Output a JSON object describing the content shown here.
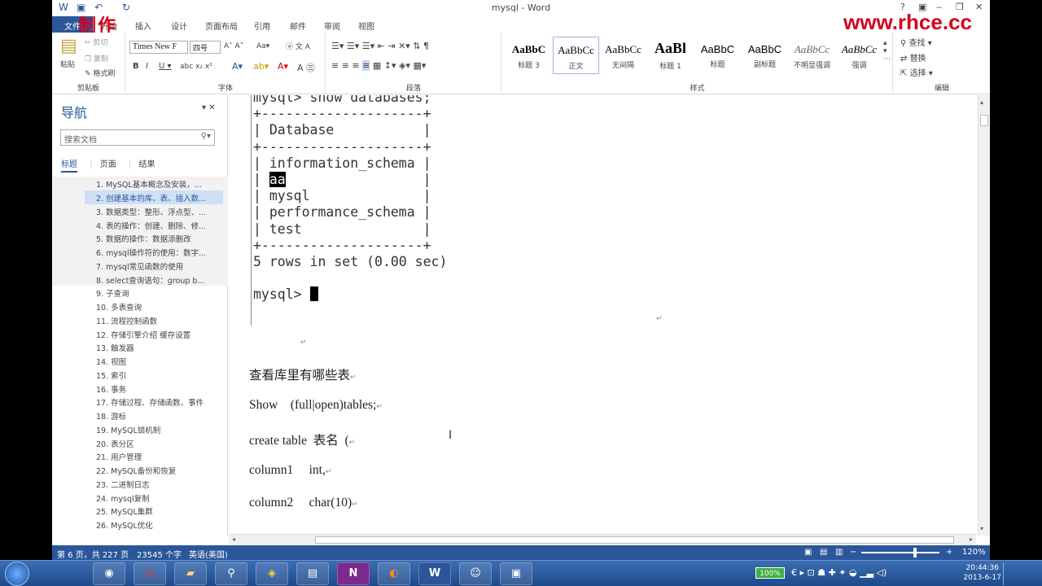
{
  "titlebar": {
    "title": "mysql - Word",
    "help": "?",
    "restore": "▣",
    "minimize": "‒",
    "maximize": "❐",
    "close": "✕"
  },
  "watermark": {
    "left": "制作",
    "right": "www.rhce.cc"
  },
  "tabs": [
    "文件",
    "开始",
    "插入",
    "设计",
    "页面布局",
    "引用",
    "邮件",
    "审阅",
    "视图"
  ],
  "ribbon": {
    "clipboard": {
      "paste": "粘贴",
      "cut": "剪切",
      "copy": "复制",
      "format_painter": "格式刷",
      "label": "剪贴板"
    },
    "font": {
      "name": "Times New F",
      "size": "四号",
      "label": "字体"
    },
    "paragraph": {
      "label": "段落"
    },
    "styles": {
      "label": "样式",
      "items": [
        {
          "preview": "AaBbC",
          "name": "标题 3"
        },
        {
          "preview": "AaBbCc",
          "name": "正文"
        },
        {
          "preview": "AaBbCc",
          "name": "无间隔"
        },
        {
          "preview": "AaBl",
          "name": "标题 1"
        },
        {
          "preview": "AaBbC",
          "name": "标题"
        },
        {
          "preview": "AaBbC",
          "name": "副标题"
        },
        {
          "preview": "AaBbCc",
          "name": "不明显强调"
        },
        {
          "preview": "AaBbCc",
          "name": "强调"
        }
      ]
    },
    "editing": {
      "find": "查找",
      "replace": "替换",
      "select": "选择",
      "label": "编辑"
    }
  },
  "nav": {
    "title": "导航",
    "search_placeholder": "搜索文档",
    "tabs": [
      "标题",
      "页面",
      "结果"
    ],
    "items": [
      "1. MySQL基本概念及安装，...",
      "2. 创建基本的库、表、插入数...",
      "3. 数据类型：整形、浮点型、...",
      "4. 表的操作：创建、删除、修...",
      "5. 数据的操作：数据添删改",
      "6. mysql操作符的使用：数字...",
      "7. mysql常见函数的使用",
      "8. select查询语句：group b...",
      "9. 子查询",
      "10. 多表查询",
      "11. 流程控制函数",
      "12. 存储引擎介绍 缓存设置",
      "13. 触发器",
      "14. 视图",
      "15. 索引",
      "16. 事务",
      "17. 存储过程、存储函数、事件",
      "18. 游标",
      "19. MySQL锁机制",
      "20. 表分区",
      "21. 用户管理",
      "22. MySQL备份和恢复",
      "23. 二进制日志",
      "24. mysql复制",
      "25. MySQL集群",
      "26. MySQL优化"
    ]
  },
  "terminal": {
    "cmd": "mysql> show databases;",
    "border": "+--------------------+",
    "header": "| Database           |",
    "rows": [
      "| information_schema |",
      "| ",
      "aa",
      "                 |",
      "| mysql              |",
      "| performance_schema |",
      "| test               |"
    ],
    "summary": "5 rows in set (0.00 sec)",
    "prompt": "mysql> "
  },
  "doc": {
    "p1": "查看库里有哪些表",
    "p2": "Show    (full|open)tables;",
    "p3": "create table  表名  (",
    "p4": "column1     int,",
    "p5": "column2     char(10)"
  },
  "status": {
    "page": "第 6 页，共 227 页",
    "words": "23545 个字",
    "lang": "英语(美国)",
    "zoom": "120%"
  },
  "clock": {
    "time": "20:44:36",
    "date": "2013-6-17"
  },
  "battery": "100%"
}
